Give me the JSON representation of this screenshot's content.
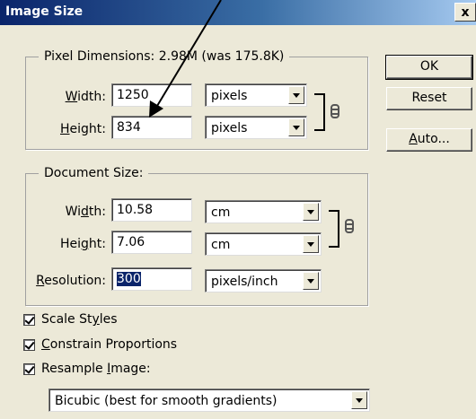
{
  "window": {
    "title": "Image Size",
    "close_label": "x"
  },
  "pixel_dimensions": {
    "legend_prefix": "Pixel Dimensions:",
    "legend_value": "2.98M (was 175.8K)",
    "width_label": "Width:",
    "width_value": "1250",
    "width_unit": "pixels",
    "height_label": "Height:",
    "height_value": "834",
    "height_unit": "pixels"
  },
  "document_size": {
    "legend": "Document Size:",
    "width_label": "Width:",
    "width_value": "10.58",
    "width_unit": "cm",
    "height_label": "Height:",
    "height_value": "7.06",
    "height_unit": "cm",
    "resolution_label": "Resolution:",
    "resolution_value": "300",
    "resolution_unit": "pixels/inch"
  },
  "buttons": {
    "ok": "OK",
    "reset": "Reset",
    "auto": "Auto..."
  },
  "options": {
    "scale_styles": "Scale Styles",
    "constrain": "Constrain Proportions",
    "resample": "Resample Image:",
    "resample_checked": true,
    "constrain_checked": true,
    "scale_checked": true,
    "method": "Bicubic (best for smooth gradients)"
  },
  "annotation": {
    "type": "arrow",
    "color": "#000000"
  }
}
